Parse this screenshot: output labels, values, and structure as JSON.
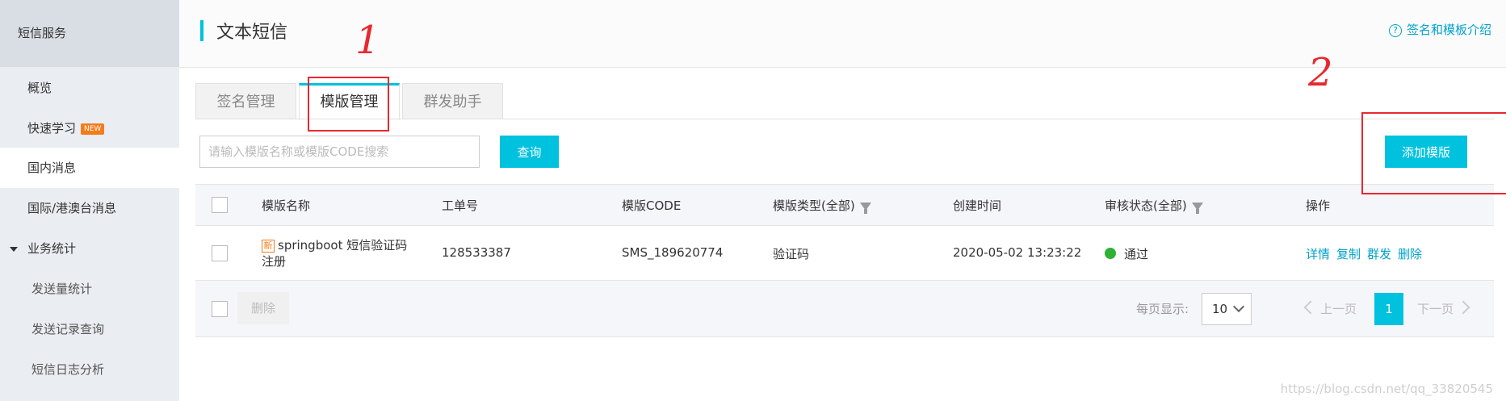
{
  "sidebar": {
    "title": "短信服务",
    "items": [
      {
        "label": "概览"
      },
      {
        "label": "快速学习",
        "badge": "NEW"
      },
      {
        "label": "国内消息"
      },
      {
        "label": "国际/港澳台消息"
      },
      {
        "label": "业务统计"
      },
      {
        "label": "发送量统计"
      },
      {
        "label": "发送记录查询"
      },
      {
        "label": "短信日志分析"
      }
    ]
  },
  "header": {
    "title": "文本短信",
    "help_icon": "?",
    "help_link": "签名和模板介绍"
  },
  "tabs": [
    {
      "label": "签名管理"
    },
    {
      "label": "模版管理"
    },
    {
      "label": "群发助手"
    }
  ],
  "toolbar": {
    "search_placeholder": "请输入模版名称或模版CODE搜索",
    "query_label": "查询",
    "add_label": "添加模版"
  },
  "table": {
    "columns": [
      "模版名称",
      "工单号",
      "模版CODE",
      "模版类型(全部)",
      "创建时间",
      "审核状态(全部)",
      "操作"
    ],
    "rows": [
      {
        "tag": "新",
        "name_line1": "springboot 短信验证码",
        "name_line2": "注册",
        "ticket": "128533387",
        "code": "SMS_189620774",
        "type": "验证码",
        "created": "2020-05-02 13:23:22",
        "status": "通过",
        "actions": [
          "详情",
          "复制",
          "群发",
          "删除"
        ]
      }
    ]
  },
  "footer": {
    "delete_label": "删除",
    "page_size_label": "每页显示:",
    "page_size": "10",
    "prev_label": "上一页",
    "current_page": "1",
    "next_label": "下一页"
  },
  "annotations": {
    "mark1": "1",
    "mark2": "2"
  },
  "watermark": "https://blog.csdn.net/qq_33820545",
  "colors": {
    "accent": "#00c1de",
    "link": "#00a2ca",
    "annotation": "#e8282f",
    "status_ok": "#2eb135",
    "new_badge": "#f47c1b"
  }
}
